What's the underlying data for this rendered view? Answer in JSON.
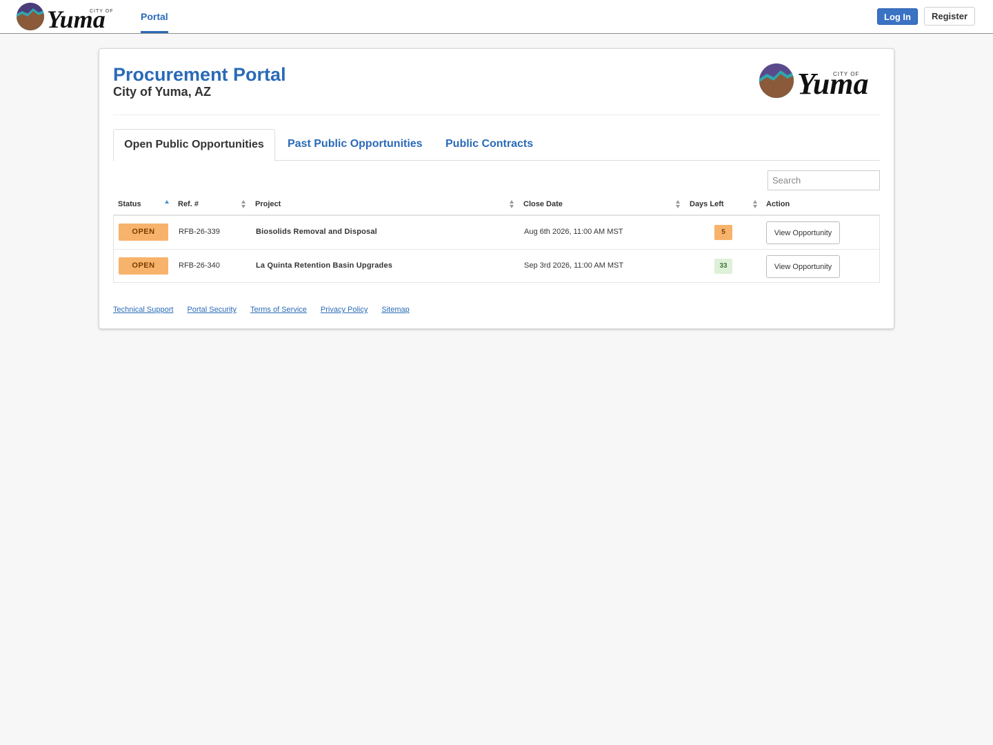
{
  "nav": {
    "brand_small": "CITY OF",
    "brand_script": "Yuma",
    "portal_label": "Portal",
    "login_label": "Log In",
    "register_label": "Register"
  },
  "header": {
    "title": "Procurement Portal",
    "subtitle": "City of Yuma, AZ"
  },
  "tabs": [
    {
      "label": "Open Public Opportunities",
      "active": true
    },
    {
      "label": "Past Public Opportunities",
      "active": false
    },
    {
      "label": "Public Contracts",
      "active": false
    }
  ],
  "search": {
    "placeholder": "Search",
    "value": ""
  },
  "table": {
    "columns": [
      "Status",
      "Ref. #",
      "Project",
      "Close Date",
      "Days Left",
      "Action"
    ],
    "sort_column": "Status",
    "sort_direction": "ascending",
    "rows": [
      {
        "status": "OPEN",
        "ref": "RFB-26-339",
        "project": "Biosolids Removal and Disposal",
        "close_date": "Aug 6th 2026, 11:00 AM MST",
        "days_left": "5",
        "action": "View Opportunity"
      },
      {
        "status": "OPEN",
        "ref": "RFB-26-340",
        "project": "La Quinta Retention Basin Upgrades",
        "close_date": "Sep 3rd 2026, 11:00 AM MST",
        "days_left": "33",
        "action": "View Opportunity"
      }
    ]
  },
  "footer": {
    "links": [
      "Technical Support",
      "Portal Security",
      "Terms of Service",
      "Privacy Policy",
      "Sitemap"
    ]
  },
  "colors": {
    "accent": "#2a6ab7",
    "login_button": "#3a72c4",
    "status_open": "#f7b36b",
    "days_warning": "#f7b36b",
    "days_ok": "#dff0d8"
  }
}
